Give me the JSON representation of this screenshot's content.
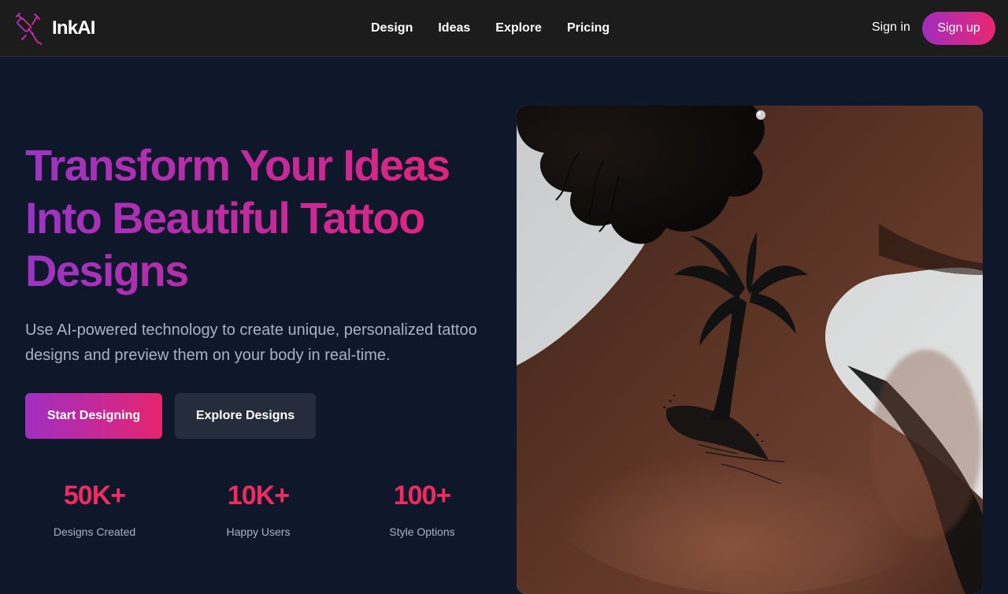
{
  "brand": {
    "name": "InkAI",
    "logo_icon": "tattoo-machine-icon",
    "logo_colors": [
      "#9b34c4",
      "#e4237a"
    ]
  },
  "nav": {
    "links": [
      {
        "label": "Design"
      },
      {
        "label": "Ideas"
      },
      {
        "label": "Explore"
      },
      {
        "label": "Pricing"
      }
    ],
    "signin_label": "Sign in",
    "signup_label": "Sign up"
  },
  "hero": {
    "title_lines": [
      "Transform Your Ideas",
      "Into Beautiful Tattoo",
      "Designs"
    ],
    "subtitle": "Use AI-powered technology to create unique, personalized tattoo designs and preview them on your body in real-time.",
    "primary_cta": "Start Designing",
    "secondary_cta": "Explore Designs",
    "image_subject": "palm-tree-neck-tattoo"
  },
  "stats": [
    {
      "value": "50K+",
      "label": "Designs Created"
    },
    {
      "value": "10K+",
      "label": "Happy Users"
    },
    {
      "value": "100+",
      "label": "Style Options"
    }
  ],
  "colors": {
    "page_background": "#0f172a",
    "navbar_background": "#1c1c1c",
    "accent_purple": "#9b34c4",
    "accent_pink": "#e4237a",
    "stat_value": "#ee2c62",
    "muted_text": "#aab2c0",
    "secondary_button": "#252d3d"
  }
}
